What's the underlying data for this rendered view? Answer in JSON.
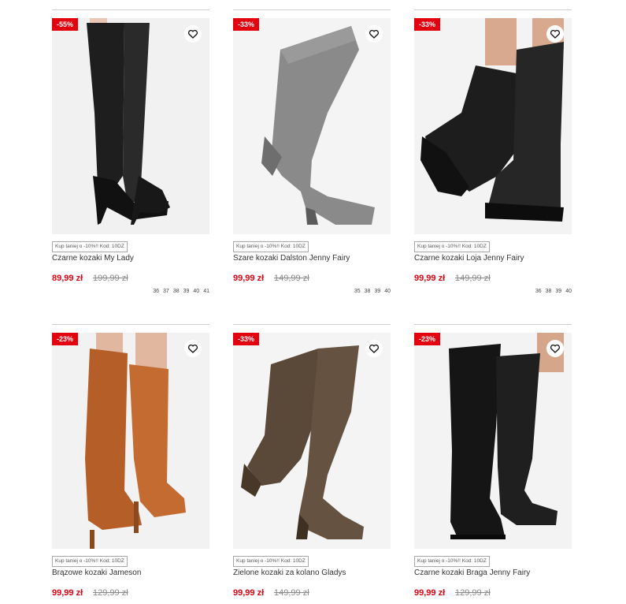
{
  "products": [
    {
      "discount": "-55%",
      "promo": "Kup taniej o -10%!! Kod: 10DZ",
      "name": "Czarne kozaki My Lady",
      "price": "89,99 zł",
      "old_price": "199,99 zł",
      "sizes": [
        "36",
        "37",
        "38",
        "39",
        "40",
        "41"
      ],
      "image": "black-stiletto-over-knee-boots",
      "color": "#1b1b1b"
    },
    {
      "discount": "-33%",
      "promo": "Kup taniej o -10%!! Kod: 10DZ",
      "name": "Szare kozaki Dalston Jenny Fairy",
      "price": "99,99 zł",
      "old_price": "149,99 zł",
      "sizes": [
        "35",
        "38",
        "39",
        "40"
      ],
      "image": "grey-block-heel-over-knee-boots",
      "color": "#7a7a7a"
    },
    {
      "discount": "-33%",
      "promo": "Kup taniej o -10%!! Kod: 10DZ",
      "name": "Czarne kozaki Loja Jenny Fairy",
      "price": "99,99 zł",
      "old_price": "149,99 zł",
      "sizes": [
        "36",
        "38",
        "39",
        "40"
      ],
      "image": "black-leather-knee-boots",
      "color": "#1a1a1a"
    },
    {
      "discount": "-23%",
      "promo": "Kup taniej o -10%!! Kod: 10DZ",
      "name": "Brązowe kozaki Jameson",
      "price": "99,99 zł",
      "old_price": "129,99 zł",
      "sizes": [],
      "image": "brown-platform-knee-boots",
      "color": "#b8602a"
    },
    {
      "discount": "-33%",
      "promo": "Kup taniej o -10%!! Kod: 10DZ",
      "name": "Zielone kozaki za kolano Gladys",
      "price": "99,99 zł",
      "old_price": "149,99 zł",
      "sizes": [],
      "image": "olive-flat-over-knee-boots",
      "color": "#5b4a3a"
    },
    {
      "discount": "-23%",
      "promo": "Kup taniej o -10%!! Kod: 10DZ",
      "name": "Czarne kozaki Braga Jenny Fairy",
      "price": "99,99 zł",
      "old_price": "129,99 zł",
      "sizes": [],
      "image": "black-flat-over-knee-boots",
      "color": "#111111"
    }
  ],
  "colors": {
    "accent": "#e3000f",
    "muted": "#888888"
  }
}
